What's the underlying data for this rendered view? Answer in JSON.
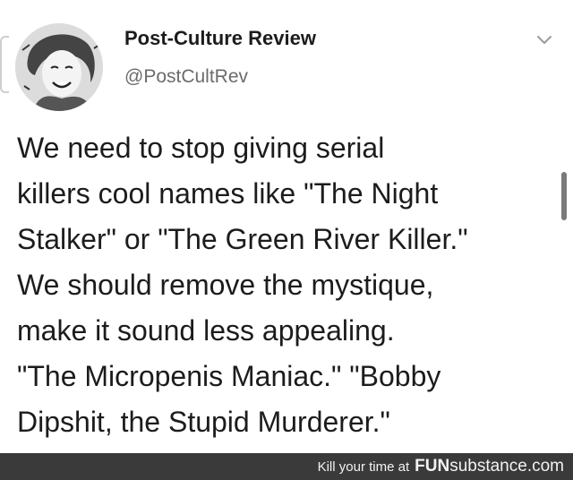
{
  "tweet": {
    "display_name": "Post-Culture Review",
    "handle": "@PostCultRev",
    "menu_icon": "chevron-down-icon",
    "lines": [
      "We need to stop giving serial",
      "killers cool names like \"The Night",
      "Stalker\" or \"The Green River Killer.\"",
      "We should remove the mystique,",
      "make it sound less appealing.",
      "\"The Micropenis Maniac.\" \"Bobby",
      "Dipshit, the Stupid Murderer.\""
    ]
  },
  "footer": {
    "prefix": "Kill your time at",
    "brand_bold": "FUN",
    "brand_rest": "substance.com"
  },
  "colors": {
    "footer_bg": "#3a3a3a",
    "handle_gray": "#6b6b6b"
  }
}
